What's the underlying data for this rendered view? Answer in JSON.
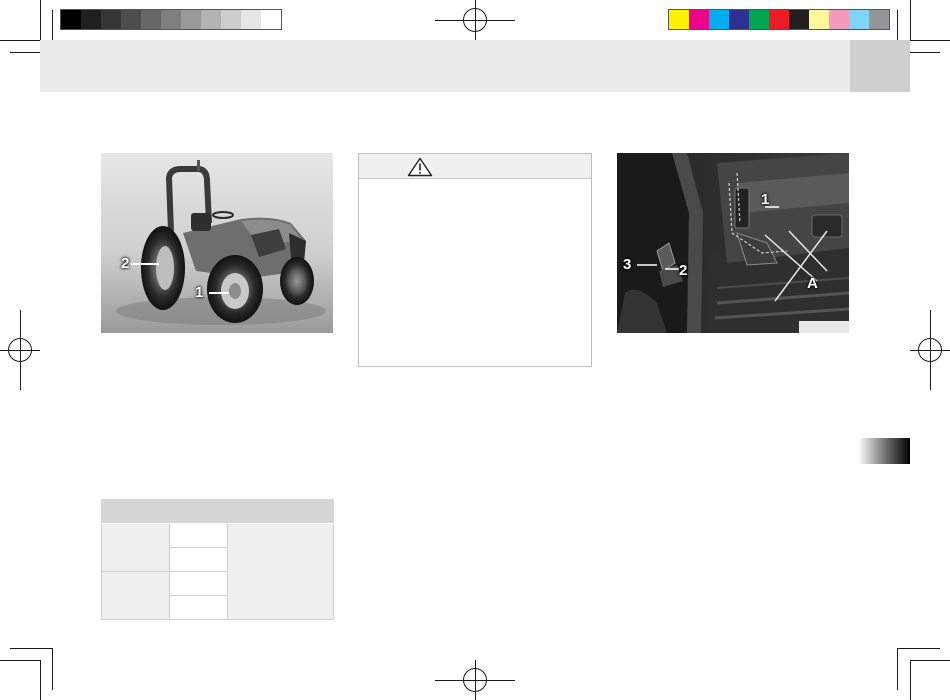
{
  "color_bar": {
    "grays": [
      "#000000",
      "#1f1f1f",
      "#363636",
      "#4d4d4d",
      "#666666",
      "#7f7f7f",
      "#999999",
      "#b3b3b3",
      "#cccccc",
      "#e6e6e6",
      "#ffffff"
    ],
    "colors": [
      "#fff200",
      "#ec008c",
      "#00aeef",
      "#2e3192",
      "#00a651",
      "#ed1c24",
      "#231f20",
      "#fff799",
      "#f49ac1",
      "#7fd4f7",
      "#939598"
    ]
  },
  "figure_tractor": {
    "callouts": [
      "2",
      "1"
    ]
  },
  "warning_box": {
    "icon": "warning-triangle-icon",
    "heading": ""
  },
  "figure_cab": {
    "callouts": [
      "1",
      "3",
      "2",
      "A"
    ],
    "caption": ""
  },
  "spec_table": {
    "headers": [
      "",
      ""
    ],
    "rows": [
      {
        "group": "",
        "subs": [
          "",
          ""
        ]
      },
      {
        "group": "",
        "subs": [
          "",
          ""
        ]
      }
    ],
    "value": ""
  }
}
